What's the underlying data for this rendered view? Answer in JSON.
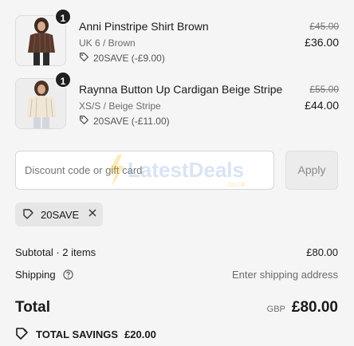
{
  "items": [
    {
      "quantity": "1",
      "name": "Anni Pinstripe Shirt Brown",
      "variant": "UK 6 / Brown",
      "discount": "20SAVE (-£9.00)",
      "original_price": "£45.00",
      "price": "£36.00",
      "tag_icon": "tag-icon"
    },
    {
      "quantity": "1",
      "name": "Raynna Button Up Cardigan Beige Stripe",
      "variant": "XS/S / Beige Stripe",
      "discount": "20SAVE (-£11.00)",
      "original_price": "£55.00",
      "price": "£44.00",
      "tag_icon": "tag-icon"
    }
  ],
  "discount": {
    "placeholder": "Discount code or gift card",
    "apply_label": "Apply",
    "applied_code": "20SAVE"
  },
  "summary": {
    "subtotal_label": "Subtotal · 2 items",
    "subtotal_value": "£80.00",
    "shipping_label": "Shipping",
    "shipping_value": "Enter shipping address",
    "total_label": "Total",
    "currency": "GBP",
    "total_value": "£80.00",
    "savings_label": "TOTAL SAVINGS",
    "savings_value": "£20.00"
  },
  "watermark": {
    "line1": "LatestDeals",
    "line2": ".co.uk"
  },
  "colors": {
    "background": "#f5f5f5",
    "badge": "#1f1f1f",
    "chip": "#e6e6e6",
    "watermark_bolt": "#f6b300",
    "watermark_text": "#7aa0d6"
  }
}
